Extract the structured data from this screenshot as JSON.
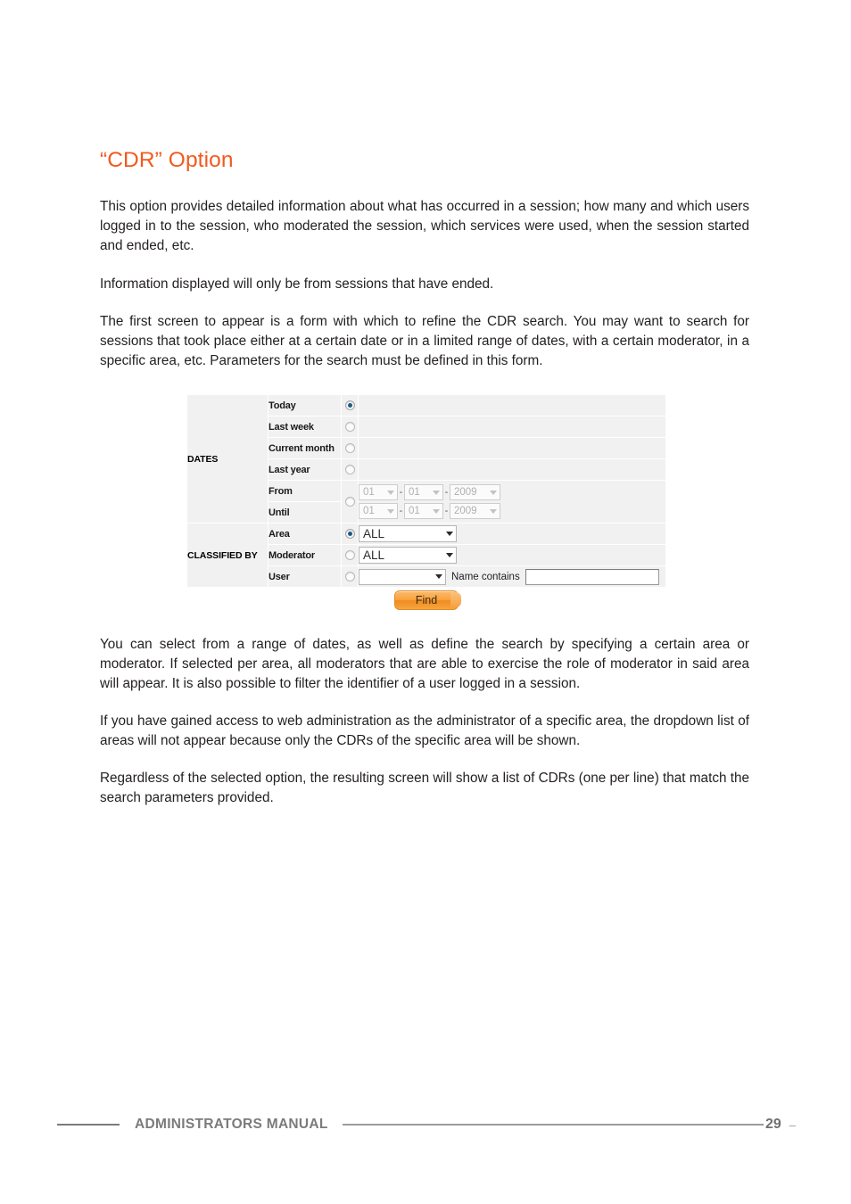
{
  "document": {
    "heading": "“CDR” Option",
    "paragraphs": [
      "This option provides detailed information about what has occurred in a session; how many and which users logged in to the session, who moderated the session, which services were used, when the session started and ended, etc.",
      "Information displayed will only be from sessions that have ended.",
      "The first screen to appear is a form with which to refine the CDR search. You may want to search for sessions that took place either at a certain date or in a limited range of dates, with a certain moderator, in a specific area, etc. Parameters for the search must be defined in this form.",
      "You can select from a range of dates, as well as define the search by specifying a certain area or moderator. If selected per area, all moderators that are able to exercise the role of moderator in said area will appear. It is also possible to filter the identifier of a user logged in a session.",
      "If you have gained access to web administration as the administrator of a specific area, the dropdown list of areas will not appear because only the CDRs of the specific area will be shown.",
      "Regardless of the selected option, the resulting screen will show a list of CDRs (one per line) that match the search parameters provided."
    ],
    "heading_color": "#F15A1E"
  },
  "figure": {
    "form": {
      "groups": {
        "dates_label": "DATES",
        "classified_by_label": "CLASSIFIED BY"
      },
      "rows": {
        "today": {
          "label": "Today",
          "selected": true
        },
        "last_week": {
          "label": "Last week",
          "selected": false
        },
        "current_month": {
          "label": "Current month",
          "selected": false
        },
        "last_year": {
          "label": "Last year",
          "selected": false
        },
        "from": {
          "label": "From",
          "selected": false
        },
        "until": {
          "label": "Until"
        },
        "area": {
          "label": "Area",
          "selected": true
        },
        "moderator": {
          "label": "Moderator",
          "selected": false
        },
        "user": {
          "label": "User",
          "selected": false
        }
      },
      "date_range": {
        "from": {
          "day": "01",
          "month": "01",
          "year": "2009"
        },
        "until": {
          "day": "01",
          "month": "01",
          "year": "2009"
        },
        "separator": "-"
      },
      "area_select_value": "ALL",
      "moderator_select_value": "ALL",
      "user_select_value": "",
      "name_contains_label": "Name contains",
      "name_contains_value": "",
      "find_button_label": "Find",
      "find_button_color": "#F5A23F"
    }
  },
  "footer": {
    "title": "ADMINISTRATORS MANUAL",
    "page_number": "29",
    "trailing_dash": "–",
    "color": "#7b7b7b"
  }
}
